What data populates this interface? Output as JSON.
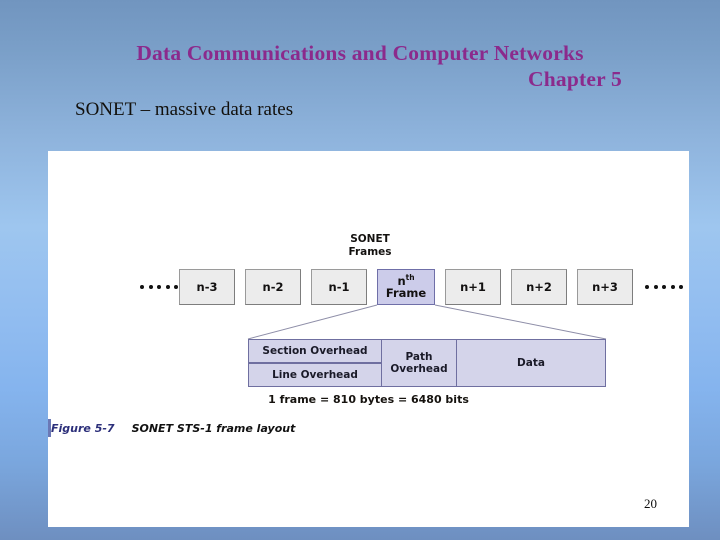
{
  "slide": {
    "title_line1": "Data Communications and Computer Networks",
    "title_line2": "Chapter 5",
    "subtitle": "SONET – massive data rates",
    "page_number": "20",
    "title_color": "#8b2a8c",
    "background_top": "#7195bf",
    "background_mid": "#9ec6ef",
    "background_bottom": "#6e8fc0"
  },
  "figure": {
    "sonet_label_line1": "SONET",
    "sonet_label_line2": "Frames",
    "frames": [
      {
        "label": "n-3",
        "highlighted": false
      },
      {
        "label": "n-2",
        "highlighted": false
      },
      {
        "label": "n-1",
        "highlighted": false
      },
      {
        "label": "nth Frame",
        "highlighted": true
      },
      {
        "label": "n+1",
        "highlighted": false
      },
      {
        "label": "n+2",
        "highlighted": false
      },
      {
        "label": "n+3",
        "highlighted": false
      }
    ],
    "highlight_frame": {
      "base": "n",
      "superscript": "th",
      "second_line": "Frame"
    },
    "ellipsis_left_dots": 5,
    "ellipsis_right_dots": 5,
    "overhead_cells": {
      "section_overhead": "Section Overhead",
      "line_overhead": "Line Overhead",
      "path_overhead_line1": "Path",
      "path_overhead_line2": "Overhead",
      "data": "Data"
    },
    "frame_size_text": "1 frame = 810 bytes = 6480 bits",
    "caption_number": "Figure 5-7",
    "caption_text": "SONET STS-1 frame layout",
    "frame_box_fill": "#ececec",
    "frame_box_border": "#9a9a9a",
    "highlight_fill": "#ccccea",
    "highlight_border": "#6f6fa8",
    "overhead_fill": "#d4d4ea",
    "overhead_border": "#6f6fa0"
  }
}
